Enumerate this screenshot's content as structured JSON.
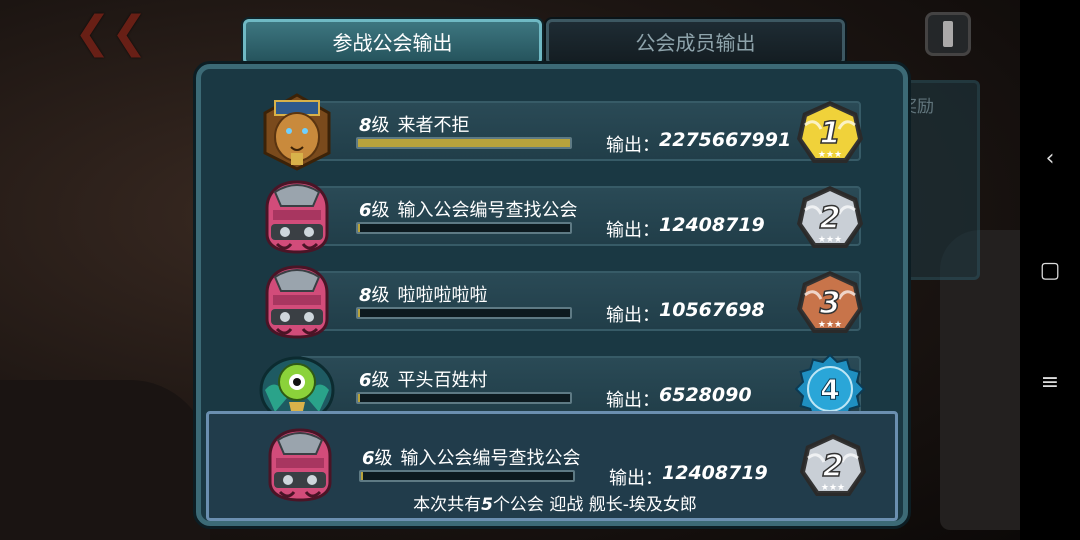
{
  "tabs": [
    {
      "label": "参战公会输出",
      "active": true
    },
    {
      "label": "公会成员输出",
      "active": false
    }
  ],
  "background": {
    "reward_label": "奖励"
  },
  "output_label": "输出：",
  "level_suffix": "级",
  "rows": [
    {
      "rank": "1",
      "level": "8",
      "name": "来者不拒",
      "output": "2275667991",
      "progress": 1.0,
      "emblem": "lion-pharaoh-emblem",
      "medal": "gold-wing-medal"
    },
    {
      "rank": "2",
      "level": "6",
      "name": "输入公会编号查找公会",
      "output": "12408719",
      "progress": 0.01,
      "emblem": "pink-robot-emblem",
      "medal": "silver-wing-medal"
    },
    {
      "rank": "3",
      "level": "8",
      "name": "啦啦啦啦啦",
      "output": "10567698",
      "progress": 0.01,
      "emblem": "pink-robot-emblem",
      "medal": "bronze-wing-medal"
    },
    {
      "rank": "4",
      "level": "6",
      "name": "平头百姓村",
      "output": "6528090",
      "progress": 0.01,
      "emblem": "green-eye-emblem",
      "medal": "blue-star-badge"
    }
  ],
  "self_row": {
    "rank": "2",
    "level": "6",
    "name": "输入公会编号查找公会",
    "output": "12408719",
    "progress": 0.01,
    "emblem": "pink-robot-emblem",
    "medal": "silver-wing-medal"
  },
  "summary": {
    "prefix": "本次共有",
    "count": "5",
    "suffix": "个公会 迎战 舰长-埃及女郎"
  },
  "colors": {
    "gold": "#f0d23a",
    "silver": "#c9cfd6",
    "bronze": "#c8744a",
    "blue": "#1f8fc1",
    "progress": "#b8a33c"
  }
}
